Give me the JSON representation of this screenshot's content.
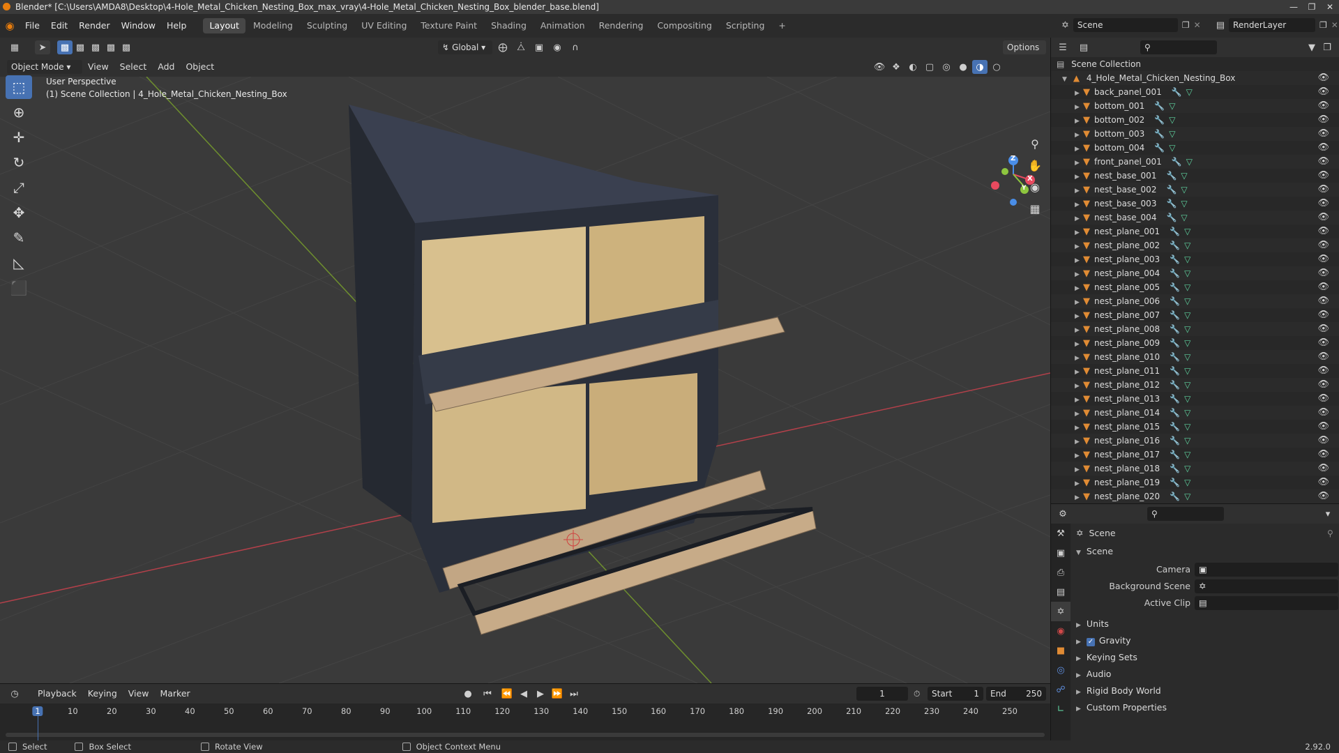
{
  "window": {
    "title": "Blender* [C:\\Users\\AMDA8\\Desktop\\4-Hole_Metal_Chicken_Nesting_Box_max_vray\\4-Hole_Metal_Chicken_Nesting_Box_blender_base.blend]",
    "controls": [
      "—",
      "❐",
      "✕"
    ]
  },
  "menus": [
    "File",
    "Edit",
    "Render",
    "Window",
    "Help"
  ],
  "workspaces": [
    "Layout",
    "Modeling",
    "Sculpting",
    "UV Editing",
    "Texture Paint",
    "Shading",
    "Animation",
    "Rendering",
    "Compositing",
    "Scripting"
  ],
  "add_workspace": "+",
  "scene_field": "Scene",
  "view_layer_field": "RenderLayer",
  "toolbar": {
    "transform_orientation": "Global",
    "options_label": "Options"
  },
  "viewport_header": {
    "mode": "Object Mode",
    "menus": [
      "View",
      "Select",
      "Add",
      "Object"
    ]
  },
  "viewport": {
    "perspective_label": "User Perspective",
    "collection_label": "(1) Scene Collection | 4_Hole_Metal_Chicken_Nesting_Box",
    "gizmo_axes": [
      "X",
      "Y",
      "Z"
    ]
  },
  "tools": [
    {
      "name": "select-box-tool",
      "glyph": "⬚",
      "active": true
    },
    {
      "name": "cursor-tool",
      "glyph": "⊕",
      "active": false
    },
    {
      "name": "move-tool",
      "glyph": "✛",
      "active": false
    },
    {
      "name": "rotate-tool",
      "glyph": "↻",
      "active": false
    },
    {
      "name": "scale-tool",
      "glyph": "⤢",
      "active": false
    },
    {
      "name": "transform-tool",
      "glyph": "✥",
      "active": false
    },
    {
      "name": "annotate-tool",
      "glyph": "✎",
      "active": false
    },
    {
      "name": "measure-tool",
      "glyph": "◺",
      "active": false
    },
    {
      "name": "add-cube-tool",
      "glyph": "⬛",
      "active": false
    }
  ],
  "outliner": {
    "root": "Scene Collection",
    "collection": "4_Hole_Metal_Chicken_Nesting_Box",
    "objects": [
      "back_panel_001",
      "bottom_001",
      "bottom_002",
      "bottom_003",
      "bottom_004",
      "front_panel_001",
      "nest_base_001",
      "nest_base_002",
      "nest_base_003",
      "nest_base_004",
      "nest_plane_001",
      "nest_plane_002",
      "nest_plane_003",
      "nest_plane_004",
      "nest_plane_005",
      "nest_plane_006",
      "nest_plane_007",
      "nest_plane_008",
      "nest_plane_009",
      "nest_plane_010",
      "nest_plane_011",
      "nest_plane_012",
      "nest_plane_013",
      "nest_plane_014",
      "nest_plane_015",
      "nest_plane_016",
      "nest_plane_017",
      "nest_plane_018",
      "nest_plane_019",
      "nest_plane_020"
    ]
  },
  "properties": {
    "context": "Scene",
    "section": "Scene",
    "fields": [
      {
        "label": "Camera",
        "value": ""
      },
      {
        "label": "Background Scene",
        "value": ""
      },
      {
        "label": "Active Clip",
        "value": ""
      }
    ],
    "subsections": [
      {
        "label": "Units",
        "checkbox": false
      },
      {
        "label": "Gravity",
        "checkbox": true
      },
      {
        "label": "Keying Sets",
        "checkbox": false
      },
      {
        "label": "Audio",
        "checkbox": false
      },
      {
        "label": "Rigid Body World",
        "checkbox": false
      },
      {
        "label": "Custom Properties",
        "checkbox": false
      }
    ]
  },
  "timeline": {
    "menus": [
      "Playback",
      "Keying",
      "View",
      "Marker"
    ],
    "current_frame": "1",
    "start_label": "Start",
    "start_value": "1",
    "end_label": "End",
    "end_value": "250",
    "ticks": [
      "1",
      "10",
      "20",
      "30",
      "40",
      "50",
      "60",
      "70",
      "80",
      "90",
      "100",
      "110",
      "120",
      "130",
      "140",
      "150",
      "160",
      "170",
      "180",
      "190",
      "200",
      "210",
      "220",
      "230",
      "240",
      "250"
    ]
  },
  "statusbar": {
    "items": [
      "Select",
      "Box Select",
      "Rotate View",
      "Object Context Menu"
    ],
    "version": "2.92.0"
  },
  "colors": {
    "accent": "#4772b3",
    "object_orange": "#e08b34",
    "axis_x": "#e84a5f",
    "axis_y": "#8ec63f",
    "axis_z": "#4a8ee8"
  }
}
